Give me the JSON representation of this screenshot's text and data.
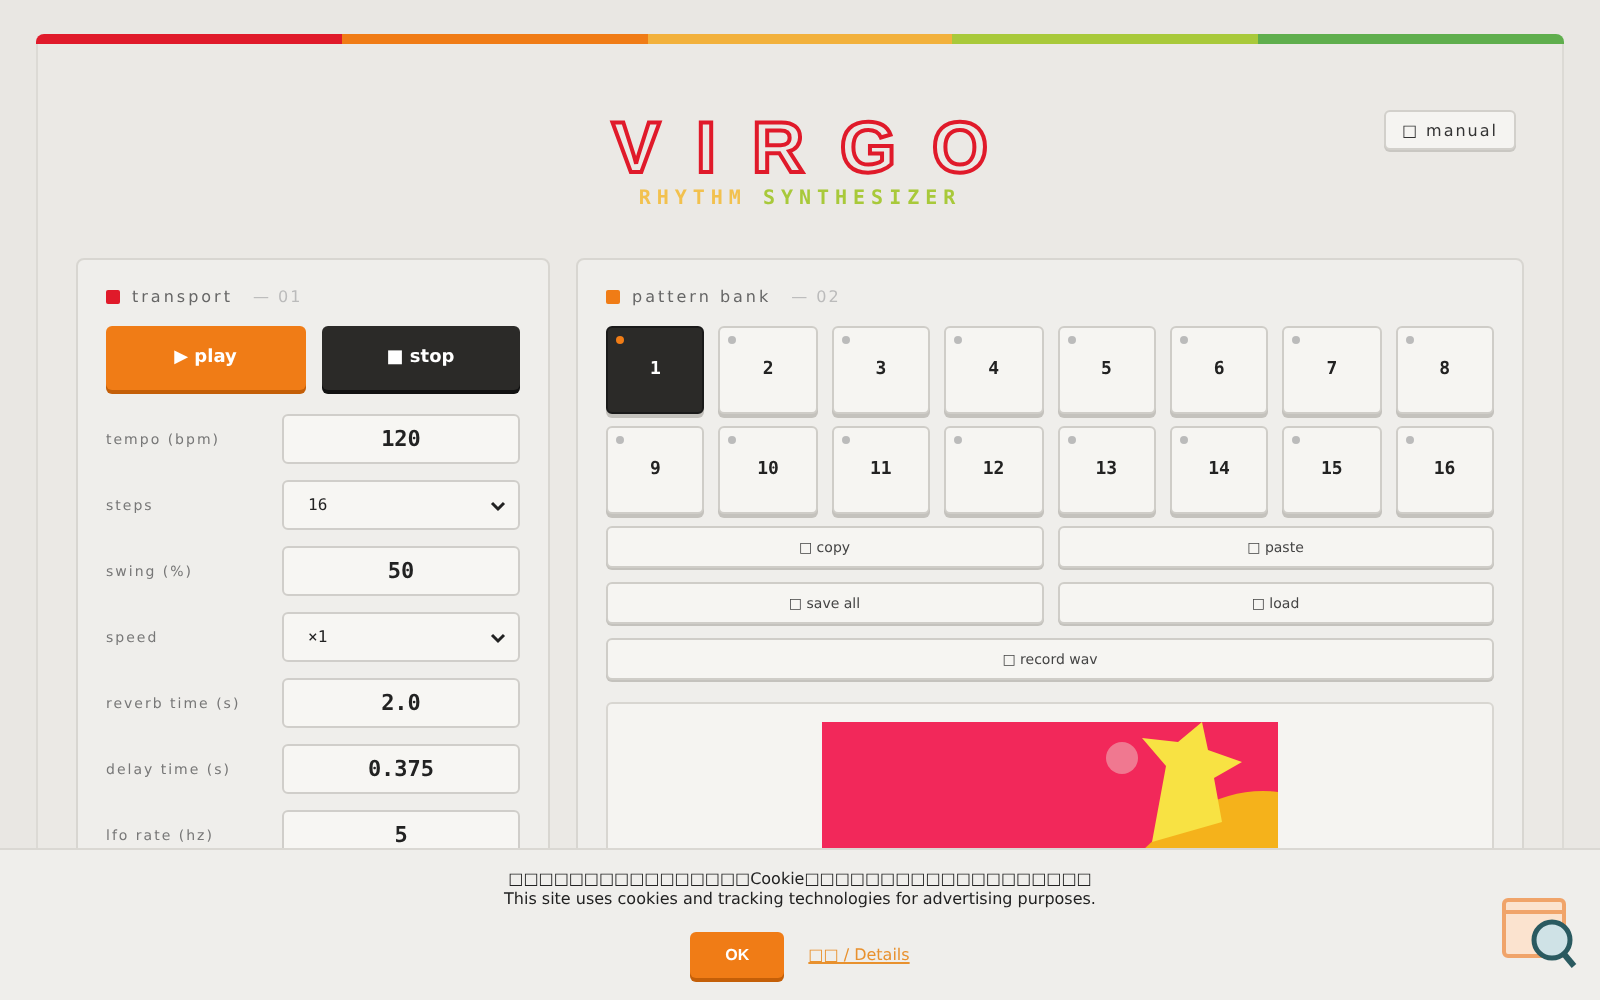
{
  "header": {
    "logo": "VIRGO",
    "subtitle": [
      {
        "text": "RHYTHM",
        "color": "#f2c14e"
      },
      {
        "text": "SYNTHESIZER",
        "color": "#a8c93a"
      }
    ],
    "manual_button": "□ manual"
  },
  "transport": {
    "title": "transport",
    "number": "— 01",
    "play": "▶ play",
    "stop": "■ stop",
    "fields": [
      {
        "label": "tempo (bpm)",
        "kind": "input",
        "value": "120"
      },
      {
        "label": "steps",
        "kind": "select",
        "value": "16"
      },
      {
        "label": "swing (%)",
        "kind": "input",
        "value": "50"
      },
      {
        "label": "speed",
        "kind": "select",
        "value": "×1"
      },
      {
        "label": "reverb time (s)",
        "kind": "input",
        "value": "2.0"
      },
      {
        "label": "delay time (s)",
        "kind": "input",
        "value": "0.375"
      },
      {
        "label": "lfo rate (hz)",
        "kind": "input",
        "value": "5"
      }
    ]
  },
  "pattern_bank": {
    "title": "pattern bank",
    "number": "— 02",
    "pads": [
      {
        "label": "1",
        "selected": true
      },
      {
        "label": "2",
        "selected": false
      },
      {
        "label": "3",
        "selected": false
      },
      {
        "label": "4",
        "selected": false
      },
      {
        "label": "5",
        "selected": false
      },
      {
        "label": "6",
        "selected": false
      },
      {
        "label": "7",
        "selected": false
      },
      {
        "label": "8",
        "selected": false
      },
      {
        "label": "9",
        "selected": false
      },
      {
        "label": "10",
        "selected": false
      },
      {
        "label": "11",
        "selected": false
      },
      {
        "label": "12",
        "selected": false
      },
      {
        "label": "13",
        "selected": false
      },
      {
        "label": "14",
        "selected": false
      },
      {
        "label": "15",
        "selected": false
      },
      {
        "label": "16",
        "selected": false
      }
    ],
    "actions": [
      {
        "label": "□ copy",
        "kind": "half"
      },
      {
        "label": "□ paste",
        "kind": "half"
      },
      {
        "label": "□ save all",
        "kind": "half"
      },
      {
        "label": "□ load",
        "kind": "half"
      },
      {
        "label": "□ record wav",
        "kind": "full"
      }
    ]
  },
  "cookie_banner": {
    "text_ja": "□□□□□□□□□□□□□□□□Cookie□□□□□□□□□□□□□□□□□□□",
    "text_en": "This site uses cookies and tracking technologies for advertising purposes.",
    "ok_button": "OK",
    "details_link": "□□ / Details"
  }
}
